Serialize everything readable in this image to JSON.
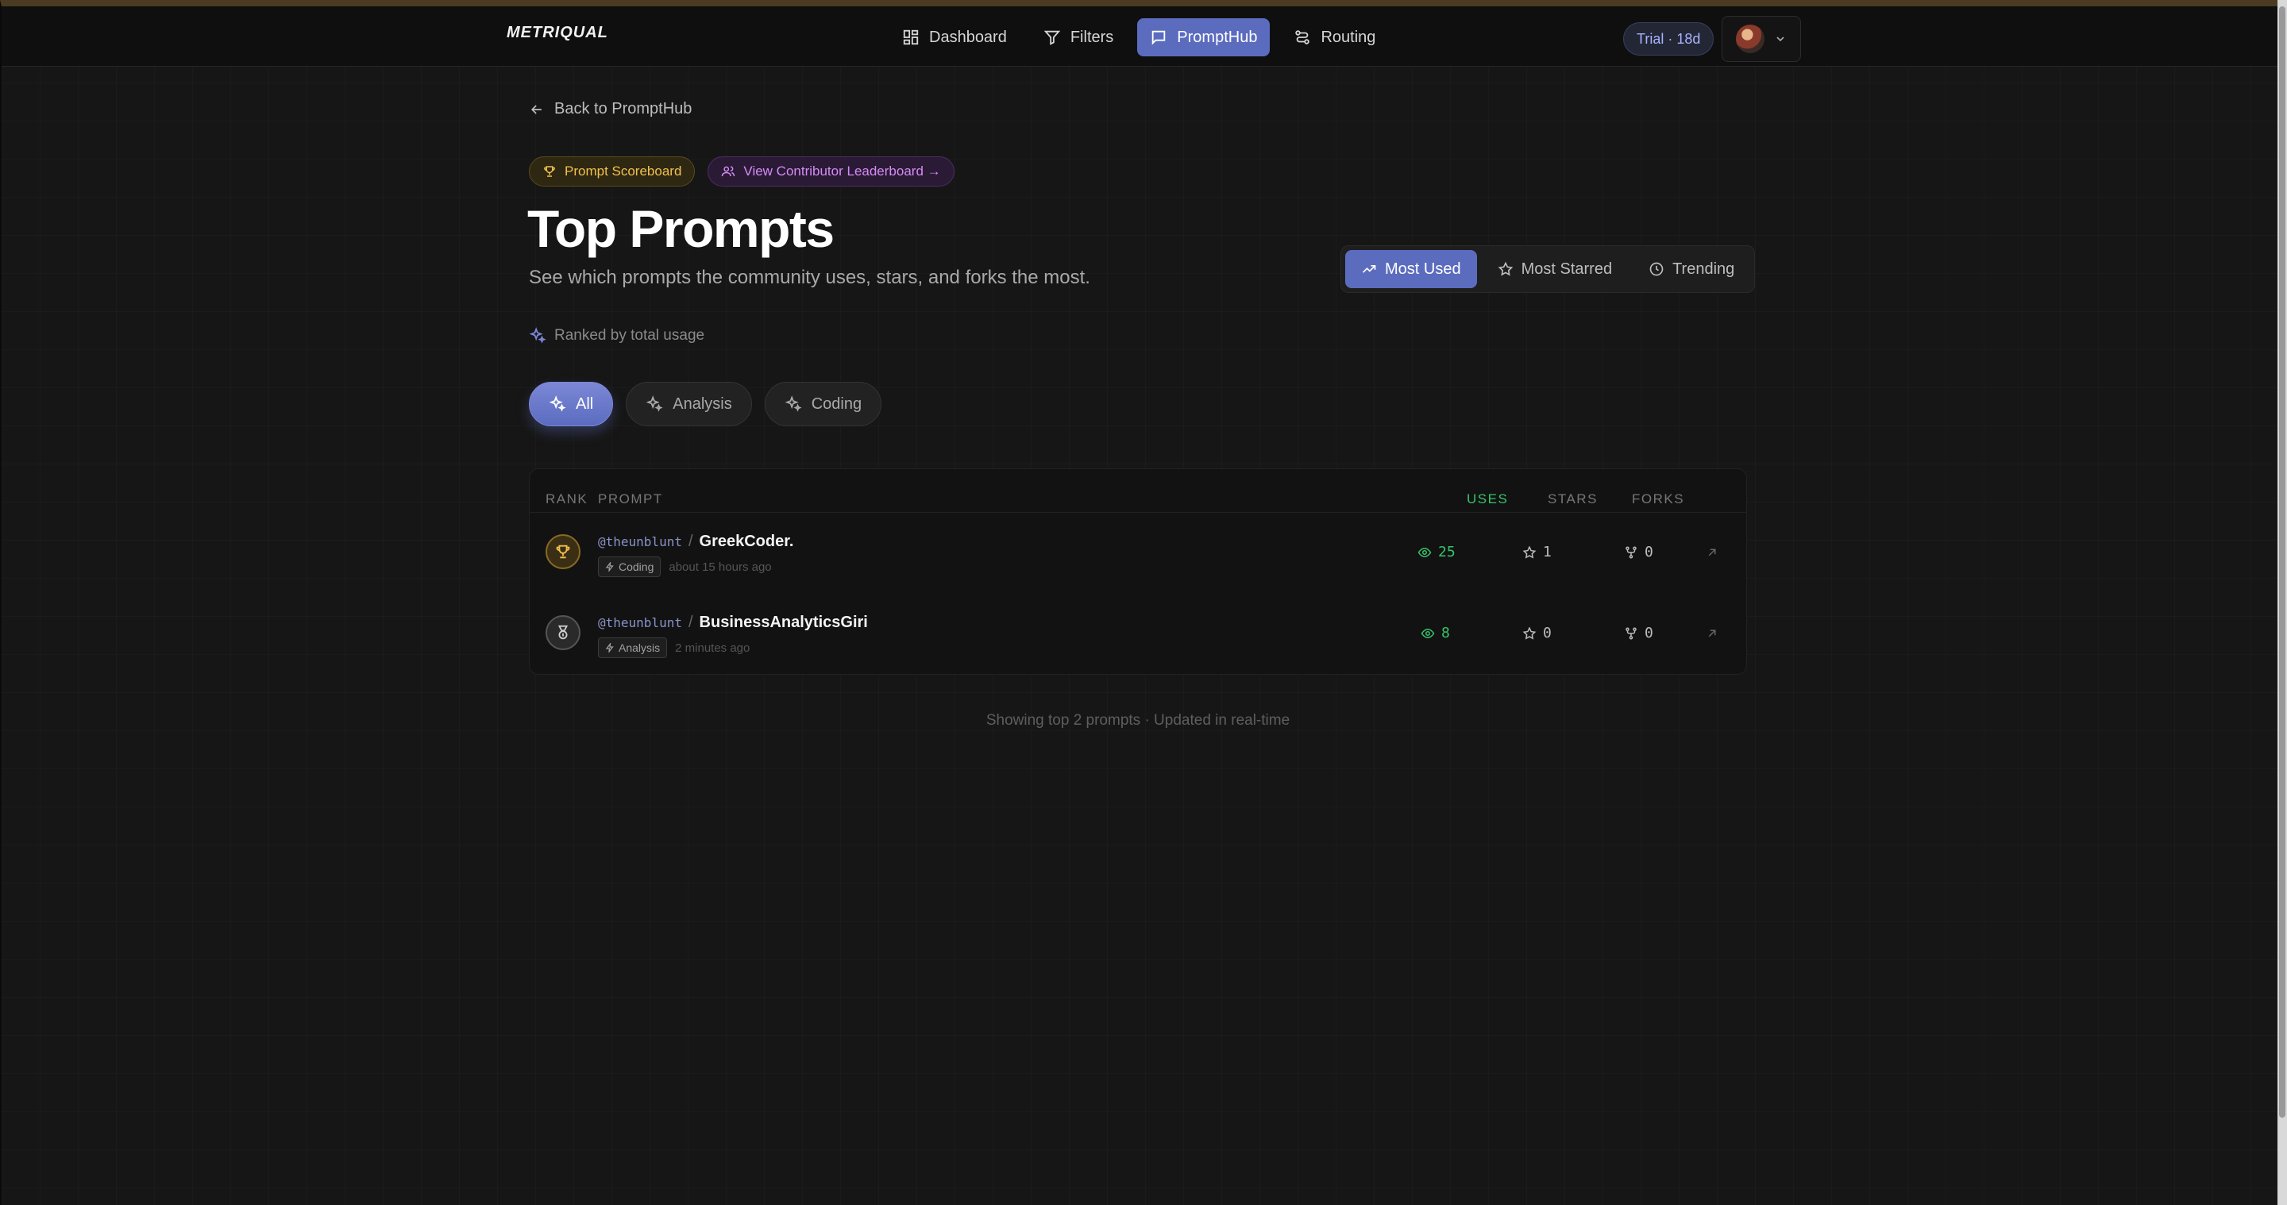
{
  "brand": {
    "logo": "METRIQUAL"
  },
  "nav": {
    "items": [
      {
        "label": "Dashboard",
        "icon": "grid-icon",
        "active": false
      },
      {
        "label": "Filters",
        "icon": "funnel-icon",
        "active": false
      },
      {
        "label": "PromptHub",
        "icon": "message-icon",
        "active": true
      },
      {
        "label": "Routing",
        "icon": "route-icon",
        "active": false
      }
    ],
    "trial_badge": "Trial · 18d"
  },
  "page": {
    "back_link": "Back to PromptHub",
    "badge_scoreboard": "Prompt Scoreboard",
    "badge_leaderboard": "View Contributor Leaderboard →",
    "title": "Top Prompts",
    "subtitle": "See which prompts the community uses, stars, and forks the most.",
    "ranked_by": "Ranked by total usage"
  },
  "sort_tabs": [
    {
      "label": "Most Used",
      "icon": "trending-up-icon",
      "active": true
    },
    {
      "label": "Most Starred",
      "icon": "star-icon",
      "active": false
    },
    {
      "label": "Trending",
      "icon": "clock-icon",
      "active": false
    }
  ],
  "categories": [
    {
      "label": "All",
      "active": true
    },
    {
      "label": "Analysis",
      "active": false
    },
    {
      "label": "Coding",
      "active": false
    }
  ],
  "table": {
    "headers": {
      "rank": "RANK",
      "prompt": "PROMPT",
      "uses": "USES",
      "stars": "STARS",
      "forks": "FORKS"
    },
    "rows": [
      {
        "author": "@theunblunt",
        "name": "GreekCoder.",
        "tag": "Coding",
        "time": "about 15 hours ago",
        "uses": "25",
        "stars": "1",
        "forks": "0",
        "rank_icon": "trophy-icon"
      },
      {
        "author": "@theunblunt",
        "name": "BusinessAnalyticsGiri",
        "tag": "Analysis",
        "time": "2 minutes ago",
        "uses": "8",
        "stars": "0",
        "forks": "0",
        "rank_icon": "medal-icon"
      }
    ]
  },
  "footer_note": "Showing top 2 prompts · Updated in real-time",
  "colors": {
    "accent": "#5b6cbf",
    "uses_green": "#37c46a",
    "gold": "#f2c14e",
    "purple": "#d48cf5"
  }
}
